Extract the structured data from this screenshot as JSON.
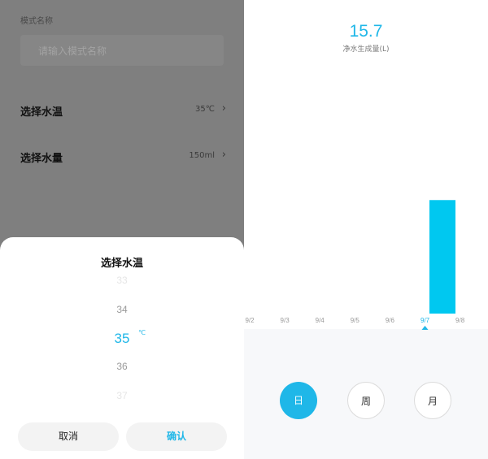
{
  "settings": {
    "name_section_title": "模式名称",
    "name_placeholder": "请输入模式名称",
    "temp_row": {
      "label": "选择水温",
      "value": "35℃"
    },
    "volume_row": {
      "label": "选择水量",
      "value": "150ml"
    }
  },
  "picker": {
    "title": "选择水温",
    "values": [
      "33",
      "34",
      "35",
      "36",
      "37"
    ],
    "selected": "35",
    "unit": "℃",
    "cancel": "取消",
    "confirm": "确认"
  },
  "stats": {
    "total_value": "15.7",
    "total_label": "净水生成量(L)",
    "period_buttons": {
      "day": "日",
      "week": "周",
      "month": "月"
    },
    "selected_period": "日"
  },
  "chart_data": {
    "type": "bar",
    "categories": [
      "9/2",
      "9/3",
      "9/4",
      "9/5",
      "9/6",
      "9/7",
      "9/8"
    ],
    "values": [
      0,
      0,
      0,
      0,
      0,
      15.7,
      0
    ],
    "selected_category": "9/7",
    "ylim": [
      0,
      20.9
    ],
    "grid": false,
    "bar_color": "#00c8f0"
  },
  "colors": {
    "accent": "#1fb7e8",
    "bar": "#00c8f0"
  }
}
